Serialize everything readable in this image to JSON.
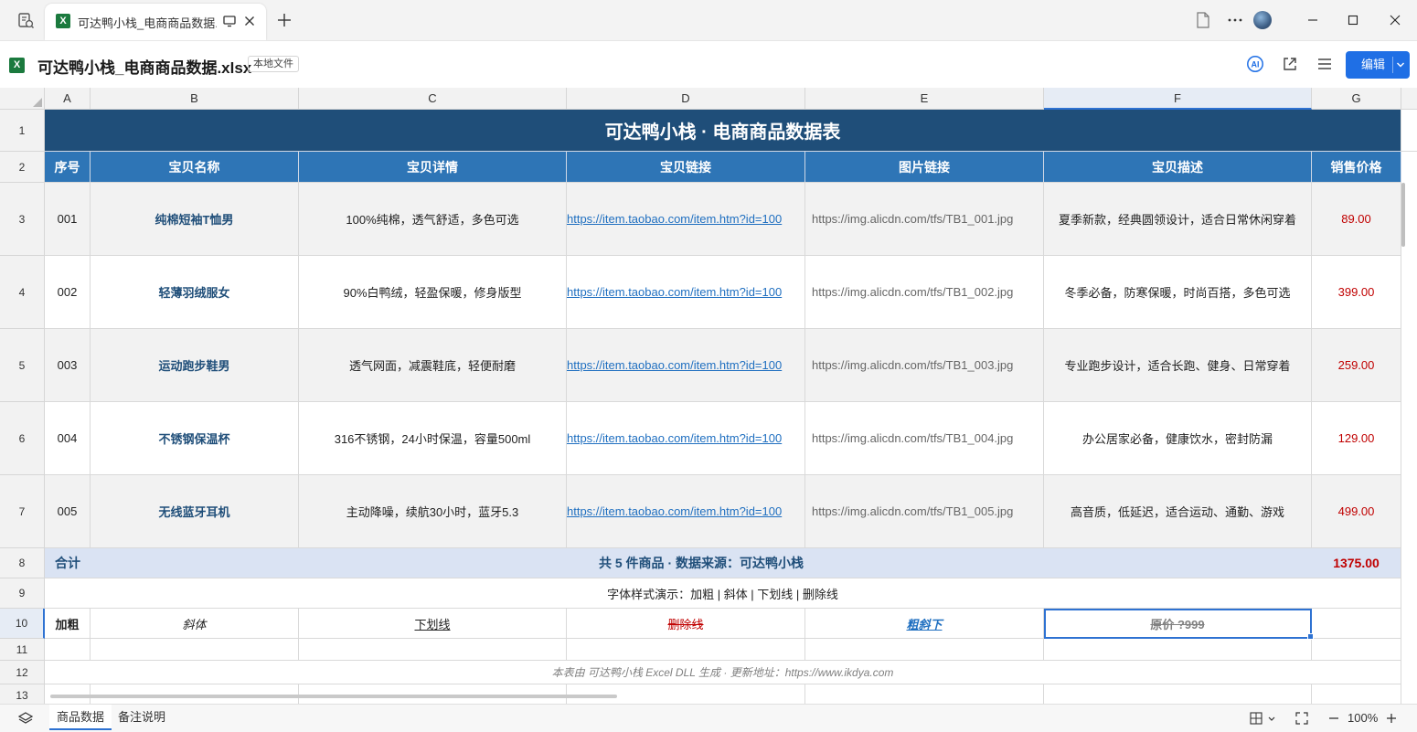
{
  "window": {
    "tab_title": "可达鸭小栈_电商商品数据.xlsx",
    "tab_xl": "X"
  },
  "doc": {
    "title": "可达鸭小栈_电商商品数据.xlsx",
    "badge": "本地文件",
    "edit_label": "编辑",
    "xl": "X"
  },
  "columns": [
    "A",
    "B",
    "C",
    "D",
    "E",
    "F",
    "G"
  ],
  "rows": [
    "1",
    "2",
    "3",
    "4",
    "5",
    "6",
    "7",
    "8",
    "9",
    "10",
    "11",
    "12",
    "13"
  ],
  "sheet": {
    "title": "可达鸭小栈 · 电商商品数据表",
    "headers": [
      "序号",
      "宝贝名称",
      "宝贝详情",
      "宝贝链接",
      "图片链接",
      "宝贝描述",
      "销售价格"
    ],
    "products": [
      {
        "id": "001",
        "name": "纯棉短袖T恤男",
        "detail": "100%纯棉，透气舒适，多色可选",
        "link": "https://item.taobao.com/item.htm?id=100",
        "image": "https://img.alicdn.com/tfs/TB1_001.jpg",
        "desc": "夏季新款，经典圆领设计，适合日常休闲穿着",
        "price": "89.00"
      },
      {
        "id": "002",
        "name": "轻薄羽绒服女",
        "detail": "90%白鸭绒，轻盈保暖，修身版型",
        "link": "https://item.taobao.com/item.htm?id=100",
        "image": "https://img.alicdn.com/tfs/TB1_002.jpg",
        "desc": "冬季必备，防寒保暖，时尚百搭，多色可选",
        "price": "399.00"
      },
      {
        "id": "003",
        "name": "运动跑步鞋男",
        "detail": "透气网面，减震鞋底，轻便耐磨",
        "link": "https://item.taobao.com/item.htm?id=100",
        "image": "https://img.alicdn.com/tfs/TB1_003.jpg",
        "desc": "专业跑步设计，适合长跑、健身、日常穿着",
        "price": "259.00"
      },
      {
        "id": "004",
        "name": "不锈钢保温杯",
        "detail": "316不锈钢，24小时保温，容量500ml",
        "link": "https://item.taobao.com/item.htm?id=100",
        "image": "https://img.alicdn.com/tfs/TB1_004.jpg",
        "desc": "办公居家必备，健康饮水，密封防漏",
        "price": "129.00"
      },
      {
        "id": "005",
        "name": "无线蓝牙耳机",
        "detail": "主动降噪，续航30小时，蓝牙5.3",
        "link": "https://item.taobao.com/item.htm?id=100",
        "image": "https://img.alicdn.com/tfs/TB1_005.jpg",
        "desc": "高音质，低延迟，适合运动、通勤、游戏",
        "price": "499.00"
      }
    ],
    "total_label": "合计",
    "total_text": "共 5 件商品 · 数据来源：可达鸭小栈",
    "total_price": "1375.00",
    "font_demo_title": "字体样式演示：加粗 | 斜体 | 下划线 | 删除线",
    "font_demo": {
      "bold": "加粗",
      "italic": "斜体",
      "underline": "下划线",
      "strike": "删除线",
      "combo": "粗斜下",
      "strike_price": "原价 ?999"
    },
    "footer": "本表由 可达鸭小栈 Excel DLL 生成 · 更新地址：https://www.ikdya.com"
  },
  "bottom": {
    "sheet_tabs": [
      "商品数据",
      "备注说明"
    ],
    "zoom": "100%"
  },
  "colors": {
    "title_bg": "#1f4e79",
    "header_bg": "#2e75b6",
    "total_bg": "#dae3f3",
    "price": "#c00000",
    "accent": "#1f6fe5"
  }
}
